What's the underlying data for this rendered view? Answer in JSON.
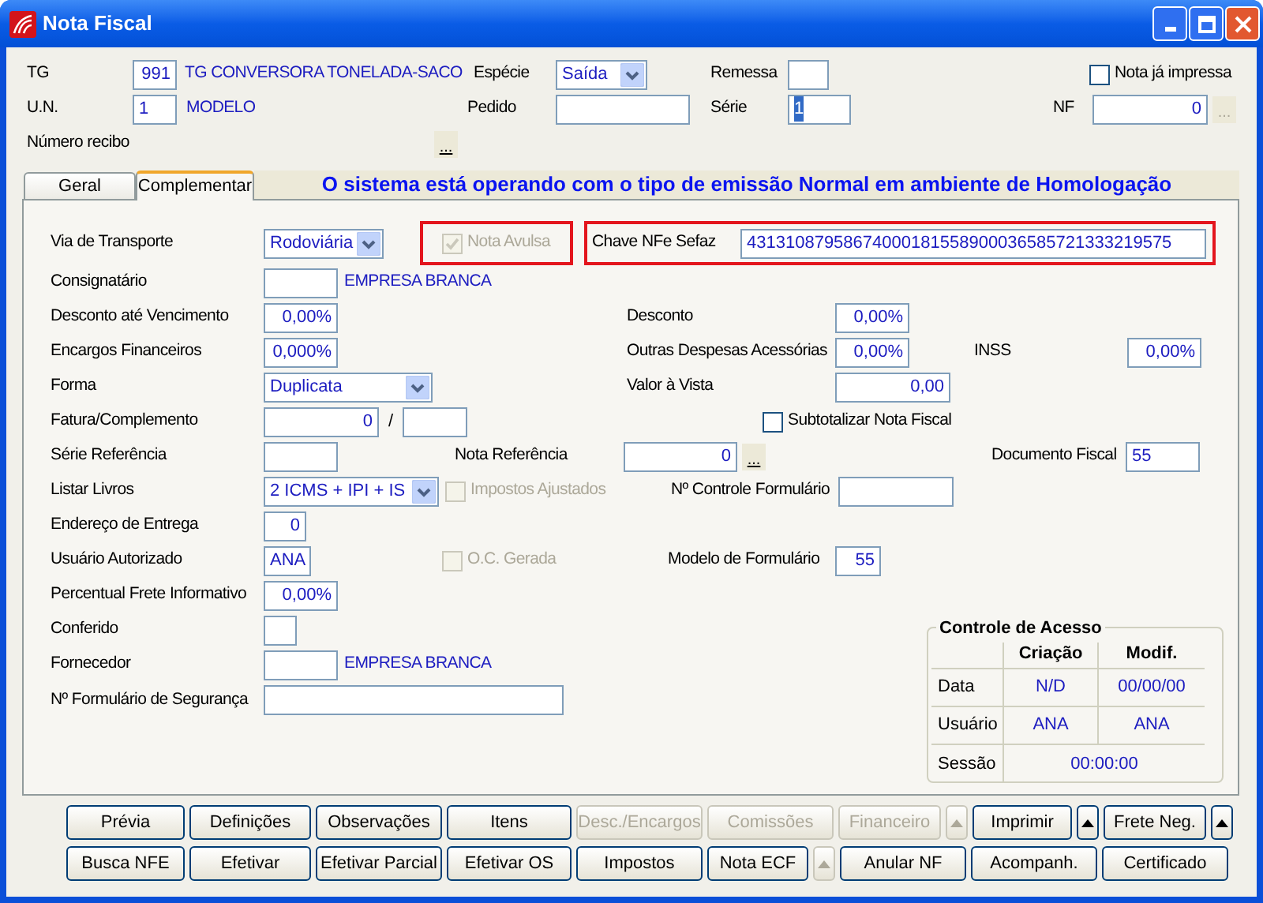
{
  "window": {
    "title": "Nota Fiscal"
  },
  "header": {
    "tg": {
      "label": "TG",
      "value": "991",
      "name": "TG CONVERSORA TONELADA-SACO"
    },
    "especie": {
      "label": "Espécie",
      "value": "Saída"
    },
    "remessa": {
      "label": "Remessa"
    },
    "nota_ja_impressa": {
      "label": "Nota já impressa",
      "checked": false
    },
    "un": {
      "label": "U.N.",
      "value": "1",
      "name": "MODELO"
    },
    "pedido": {
      "label": "Pedido"
    },
    "serie": {
      "label": "Série",
      "value": "1",
      "focused": true
    },
    "nf": {
      "label": "NF",
      "value": "0",
      "lookup": "...",
      "lookup_disabled": true
    },
    "numero_recibo": {
      "label": "Número recibo",
      "lookup": "...",
      "lookup_disabled": false
    }
  },
  "tabs": [
    {
      "label": "Geral",
      "selected": false
    },
    {
      "label": "Complementar",
      "selected": true
    }
  ],
  "banner": "O sistema está operando com o tipo de emissão Normal em ambiente de Homologação",
  "form": {
    "via_transporte": {
      "label": "Via de Transporte",
      "value": "Rodoviária"
    },
    "nota_avulsa": {
      "label": "Nota Avulsa",
      "checked": true,
      "disabled": true,
      "highlighted": true
    },
    "chave_nfe": {
      "label": "Chave NFe Sefaz",
      "value": "43131087958674000181558900036585721333219575",
      "highlighted": true
    },
    "consignatario": {
      "label": "Consignatário",
      "name": "EMPRESA BRANCA"
    },
    "desconto_vencimento": {
      "label": "Desconto até Vencimento",
      "value": "0,00%"
    },
    "desconto": {
      "label": "Desconto",
      "value": "0,00%"
    },
    "encargos": {
      "label": "Encargos Financeiros",
      "value": "0,000%"
    },
    "outras_despesas": {
      "label": "Outras Despesas Acessórias",
      "value": "0,00%"
    },
    "inss": {
      "label": "INSS",
      "value": "0,00%"
    },
    "forma": {
      "label": "Forma",
      "value": "Duplicata"
    },
    "valor_vista": {
      "label": "Valor à Vista",
      "value": "0,00"
    },
    "fatura": {
      "label": "Fatura/Complemento",
      "value": "0",
      "separator": "/"
    },
    "subtotalizar": {
      "label": "Subtotalizar Nota Fiscal",
      "checked": false,
      "disabled": false
    },
    "serie_referencia": {
      "label": "Série Referência"
    },
    "nota_referencia": {
      "label": "Nota Referência",
      "value": "0",
      "lookup": "..."
    },
    "documento_fiscal": {
      "label": "Documento Fiscal",
      "value": "55"
    },
    "listar_livros": {
      "label": "Listar Livros",
      "value": "2 ICMS + IPI + IS"
    },
    "impostos_ajustados": {
      "label": "Impostos Ajustados",
      "checked": false,
      "disabled": true
    },
    "controle_formulario": {
      "label": "Nº Controle Formulário"
    },
    "endereco_entrega": {
      "label": "Endereço de Entrega",
      "value": "0"
    },
    "usuario_autorizado": {
      "label": "Usuário Autorizado",
      "value": "ANA"
    },
    "oc_gerada": {
      "label": "O.C. Gerada",
      "checked": false,
      "disabled": true
    },
    "modelo_formulario": {
      "label": "Modelo de Formulário",
      "value": "55"
    },
    "percentual_frete": {
      "label": "Percentual Frete Informativo",
      "value": "0,00%"
    },
    "conferido": {
      "label": "Conferido"
    },
    "fornecedor": {
      "label": "Fornecedor",
      "name": "EMPRESA BRANCA"
    },
    "formulario_seguranca": {
      "label": "Nº Formulário de Segurança"
    }
  },
  "controle_acesso": {
    "title": "Controle de Acesso",
    "columns": [
      "Criação",
      "Modif."
    ],
    "rows": [
      {
        "label": "Data",
        "values": [
          "N/D",
          "00/00/00"
        ]
      },
      {
        "label": "Usuário",
        "values": [
          "ANA",
          "ANA"
        ]
      },
      {
        "label": "Sessão",
        "values": [
          "00:00:00"
        ]
      }
    ]
  },
  "buttons": [
    [
      {
        "kind": "button",
        "label": "Prévia",
        "disabled": false
      },
      {
        "kind": "button",
        "label": "Definições",
        "disabled": false
      },
      {
        "kind": "button",
        "label": "Observações",
        "disabled": false
      },
      {
        "kind": "button",
        "label": "Itens",
        "disabled": false
      },
      {
        "kind": "button",
        "label": "Desc./Encargos",
        "disabled": true
      },
      {
        "kind": "button",
        "label": "Comissões",
        "disabled": true
      },
      {
        "kind": "button",
        "label": "Financeiro",
        "disabled": true
      },
      {
        "kind": "arrow",
        "disabled": true
      },
      {
        "kind": "button",
        "label": "Imprimir",
        "disabled": false
      },
      {
        "kind": "arrow",
        "disabled": false
      },
      {
        "kind": "button",
        "label": "Frete Neg.",
        "disabled": false
      },
      {
        "kind": "arrow",
        "disabled": false
      }
    ],
    [
      {
        "kind": "button",
        "label": "Busca NFE",
        "disabled": false
      },
      {
        "kind": "button",
        "label": "Efetivar",
        "disabled": false
      },
      {
        "kind": "button",
        "label": "Efetivar Parcial",
        "disabled": false
      },
      {
        "kind": "button",
        "label": "Efetivar OS",
        "disabled": false
      },
      {
        "kind": "button",
        "label": "Impostos",
        "disabled": false
      },
      {
        "kind": "button",
        "label": "Nota ECF",
        "disabled": false
      },
      {
        "kind": "arrow",
        "disabled": true
      },
      {
        "kind": "button",
        "label": "Anular NF",
        "disabled": false
      },
      {
        "kind": "button",
        "label": "Acompanh.",
        "disabled": false
      },
      {
        "kind": "button",
        "label": "Certificado",
        "disabled": false
      }
    ]
  ]
}
